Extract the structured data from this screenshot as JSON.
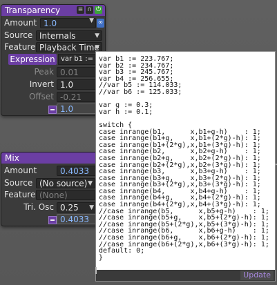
{
  "transparency": {
    "title": "Transparency",
    "amount_label": "Amount",
    "amount_value": "1.0",
    "source_label": "Source",
    "source_value": "Internals",
    "feature_label": "Feature",
    "feature_value": "Playback Time",
    "expression_button": "Expression",
    "expression_preview": "var b1 :=  ...",
    "peak_label": "Peak",
    "peak_value": "0.01",
    "invert_label": "Invert",
    "invert_value": "1.0",
    "offset_label": "Offset",
    "offset_value": "-0.21",
    "output_value": "1.0",
    "title_icons": [
      "stack-icon",
      "headphones-icon",
      "power-icon"
    ],
    "accent_color": "#6b3ea3"
  },
  "mix": {
    "title": "Mix",
    "amount_label": "Amount",
    "amount_value": "0.4033",
    "source_label": "Source",
    "source_value": "(No source)",
    "feature_label": "Feature",
    "feature_value": "(None)",
    "osc_label": "Tri. Osc",
    "osc_value": "0.25",
    "output_value": "0.4033"
  },
  "editor": {
    "code": "var b1 := 223.767;\nvar b2 := 234.767;\nvar b3 := 245.767;\nvar b4 := 256.655;\n//var b5 := 114.033;\n//var b6 := 125.033;\n\nvar g := 0.3;\nvar h := 0.1;\n\nswitch {\ncase inrange(b1,      x,b1+g-h)    : 1;\ncase inrange(b1+g,    x,b1+(2*g)-h): 1;\ncase inrange(b1+(2*g),x,b1+(3*g)-h): 1;\ncase inrange(b2,      x,b2+g-h)    : 1;\ncase inrange(b2+g,    x,b2+(2*g)-h): 1;\ncase inrange(b2+(2*g),x,b2+(3*g)-h): 1;\ncase inrange(b3,      x,b3+g-h)    : 1;\ncase inrange(b3+g,    x,b3+(2*g)-h): 1;\ncase inrange(b3+(2*g),x,b3+(3*g)-h): 1;\ncase inrange(b4,      x,b4+g-h)    : 1;\ncase inrange(b4+g,    x,b4+(2*g)-h): 1;\ncase inrange(b4+(2*g),x,b4+(3*g)-h): 1;\n//case inrange(b5,      x,b5+g-h)    : 1;\n//case inrange(b5+g,    x,b5+(2*g)-h): 1;\n//case inrange(b5+(2*g),x,b5+(3*g)-h): 1;\n//case inrange(b6,      x,b6+g-h)    : 1;\n//case inrange(b6+g,    x,b6+(2*g)-h): 1;\n//case inrange(b6+(2*g),x,b6+(3*g)-h): 1;\ndefault: 0;\n}",
    "update_button": "Update"
  }
}
